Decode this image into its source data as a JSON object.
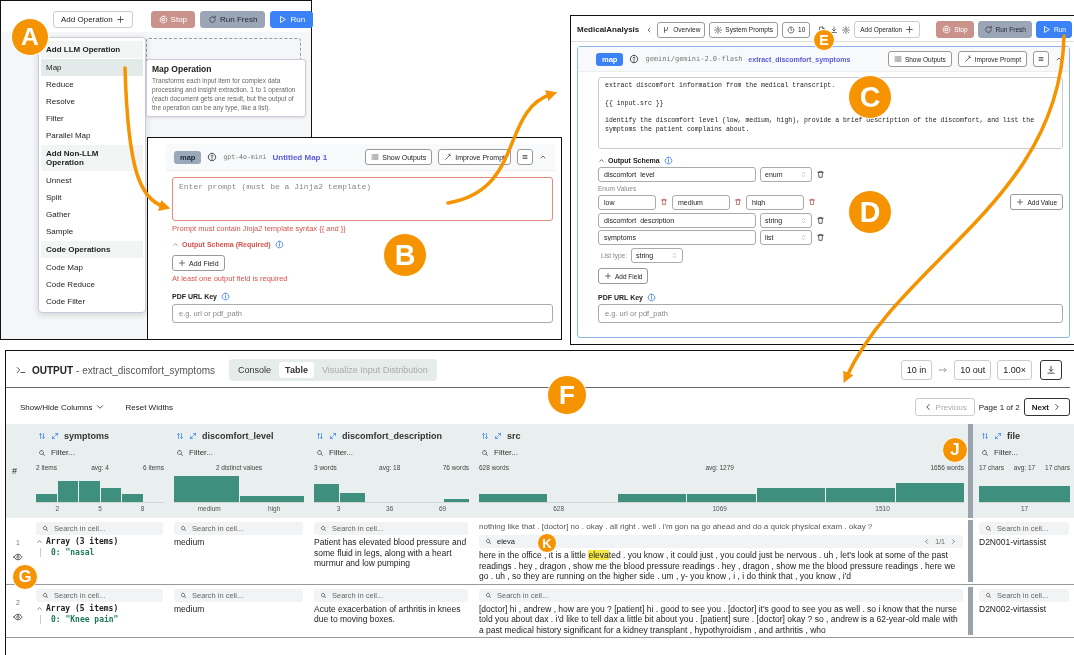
{
  "badges": [
    {
      "label": "A"
    },
    {
      "label": "B"
    },
    {
      "label": "C"
    },
    {
      "label": "D"
    },
    {
      "label": "E"
    },
    {
      "label": "F"
    },
    {
      "label": "G"
    },
    {
      "label": "J"
    },
    {
      "label": "K"
    }
  ],
  "panel_a": {
    "toolbar": [
      {
        "label": "Add Operation",
        "kind": "add"
      },
      {
        "label": "Stop",
        "kind": "stop"
      },
      {
        "label": "Run Fresh",
        "kind": "fresh"
      },
      {
        "label": "Run",
        "kind": "run"
      }
    ],
    "menu": [
      {
        "heading": "Add LLM Operation",
        "items": [
          {
            "label": "Map",
            "selected": true
          },
          {
            "label": "Reduce",
            "selected": false
          },
          {
            "label": "Resolve",
            "selected": false
          },
          {
            "label": "Filter",
            "selected": false
          },
          {
            "label": "Parallel Map",
            "selected": false
          }
        ]
      },
      {
        "heading": "Add Non-LLM Operation",
        "items": [
          {
            "label": "Unnest",
            "selected": false
          },
          {
            "label": "Split",
            "selected": false
          },
          {
            "label": "Gather",
            "selected": false
          },
          {
            "label": "Sample",
            "selected": false
          }
        ]
      },
      {
        "heading": "Code Operations",
        "items": [
          {
            "label": "Code Map",
            "selected": false
          },
          {
            "label": "Code Reduce",
            "selected": false
          },
          {
            "label": "Code Filter",
            "selected": false
          }
        ]
      }
    ],
    "tooltip": {
      "title": "Map Operation",
      "text": "Transforms each input item for complex data processing and insight extraction. 1 to 1 operation (each document gets one result, but the output of the operation can be any type, like a list)."
    }
  },
  "panel_b": {
    "op_type": "map",
    "model": "gpt-4o-mini",
    "name": "Untitled Map 1",
    "buttons": [
      {
        "label": "Show Outputs",
        "kind": "outputs"
      },
      {
        "label": "Improve Prompt",
        "kind": "improve"
      }
    ],
    "prompt": {
      "placeholder": "Enter prompt (must be a Jinja2 template)"
    },
    "prompt_error": "Prompt must contain Jinja2 template syntax {{ and }}",
    "schema_heading": "Output Schema (Required)",
    "add_field": "Add Field",
    "schema_error": "At least one output field is required",
    "pdf_label": "PDF URL Key",
    "pdf_input": {
      "placeholder": "e.g. url or pdf_path"
    }
  },
  "panel_c": {
    "title": "MedicalAnalysis",
    "nav": [
      {
        "label": "Overview",
        "kind": "branch"
      },
      {
        "label": "System Prompts",
        "kind": "gear"
      },
      {
        "label": "10",
        "kind": "clock"
      }
    ],
    "toolbar": [
      {
        "label": "Add Operation",
        "kind": "add"
      },
      {
        "label": "Stop",
        "kind": "stop"
      },
      {
        "label": "Run Fresh",
        "kind": "fresh"
      },
      {
        "label": "Run",
        "kind": "run"
      }
    ],
    "op_type": "map",
    "model": "gemini/gemini-2.0-flash",
    "name": "extract_discomfort_symptoms",
    "buttons": [
      {
        "label": "Show Outputs",
        "kind": "outputs"
      },
      {
        "label": "Improve Prompt",
        "kind": "improve"
      }
    ],
    "prompt": {
      "value": "extract discomfort information from the medical transcript.\n\n{{ input.src }}\n\nidentify the discomfort level (low, medium, high), provide a brief description of the discomfort, and list the symptoms the patient complains about."
    },
    "schema_heading": "Output Schema",
    "fields": [
      {
        "name": "discomfort_level",
        "type": "enum",
        "enum_label": "Enum Values",
        "enum_values": [
          "low",
          "medium",
          "high"
        ],
        "add_value": "Add Value"
      },
      {
        "name": "discomfort_description",
        "type": "string"
      },
      {
        "name": "symptoms",
        "type": "list",
        "list_label": "List type:",
        "list_type": "string"
      }
    ],
    "add_field": "Add Field",
    "pdf_label": "PDF URL Key",
    "pdf_input": {
      "placeholder": "e.g. url or pdf_path"
    }
  },
  "output": {
    "title": "OUTPUT",
    "subtitle": "- extract_discomfort_symptoms",
    "tabs": [
      {
        "label": "Console",
        "selected": false,
        "disabled": false
      },
      {
        "label": "Table",
        "selected": true,
        "disabled": false
      },
      {
        "label": "Visualize Input Distribution",
        "selected": false,
        "disabled": true
      }
    ],
    "count_in": "10 in",
    "count_out": "10 out",
    "speed": "1.00×",
    "show_hide": "Show/Hide Columns",
    "reset_widths": "Reset Widths",
    "previous": {
      "label": "Previous",
      "disabled": true
    },
    "page": "Page 1 of 2",
    "next": {
      "label": "Next",
      "disabled": false
    },
    "index_header": "#",
    "columns": [
      {
        "name": "symptoms",
        "filter_placeholder": "Filter...",
        "stats": [
          "2 items",
          "avg: 4",
          "6 items"
        ],
        "axis": [
          "2",
          "5",
          "8"
        ]
      },
      {
        "name": "discomfort_level",
        "filter_placeholder": "Filter...",
        "stats": [
          "2 distinct values"
        ],
        "axis": [
          "medium",
          "high"
        ]
      },
      {
        "name": "discomfort_description",
        "filter_placeholder": "Filter...",
        "stats": [
          "3 words",
          "avg: 18",
          "76 words"
        ],
        "axis": [
          "3",
          "36",
          "69"
        ]
      },
      {
        "name": "src",
        "filter_placeholder": "Filter...",
        "stats": [
          "628 words",
          "avg: 1279",
          "1656 words"
        ],
        "axis": [
          "628",
          "1069",
          "1510"
        ]
      },
      {
        "name": "file",
        "filter_placeholder": "Filter...",
        "stats": [
          "17 chars",
          "avg: 17",
          "17 chars"
        ],
        "axis": [
          "17"
        ]
      }
    ],
    "rows": [
      {
        "index": "1",
        "search": [
          {
            "placeholder": "Search in cell..."
          },
          {
            "placeholder": "Search in cell..."
          },
          {
            "placeholder": "Search in cell..."
          },
          {
            "value": "eleva",
            "matches": "1/1"
          },
          {
            "placeholder": "Search in cell..."
          }
        ],
        "symptoms": {
          "summary": "Array (3 items)",
          "first": "0: \"nasal"
        },
        "discomfort_level": "medium",
        "description": "Patient has elevated blood pressure and some fluid in legs, along with a heart murmur and low pumping",
        "src_above": "nothing like that . [doctor] no . okay . all right . well . i'm gon na go ahead and do a quick physical exam . okay ?",
        "src": [
          {
            "text": "here in the office , it is a little ",
            "highlighted": false
          },
          {
            "text": "eleva",
            "highlighted": true
          },
          {
            "text": "ted . you know , it could just , you could just be nervous . uh , let's look at some of the past readings . hey , dragon , show me the blood pressure readings . hey , dragon , show me the blood pressure readings . here we go . uh , so they are running on the higher side . um , y- you know , i , i do think that , you know , i'd",
            "highlighted": false
          }
        ],
        "file": "D2N001-virtassist"
      },
      {
        "index": "2",
        "search": [
          {
            "placeholder": "Search in cell..."
          },
          {
            "placeholder": "Search in cell..."
          },
          {
            "placeholder": "Search in cell..."
          },
          {
            "placeholder": "Search in cell..."
          },
          {
            "placeholder": "Search in cell..."
          }
        ],
        "symptoms": {
          "summary": "Array (5 items)",
          "first": "0: \"Knee pain\""
        },
        "discomfort_level": "medium",
        "description": "Acute exacerbation of arthritis in knees due to moving boxes.",
        "src": [
          {
            "text": "[doctor] hi , andrew , how are you ? [patient] hi . good to see you . [doctor] it's good to see you as well . so i know that the nurse told you about dax . i'd like to tell dax a little bit about you . [patient] sure . [doctor] okay ? so , andrew is a 62-year-old male with a past medical history significant for a kidney transplant , hypothyroidism , and arthritis , who",
            "highlighted": false
          }
        ],
        "file": "D2N002-virtassist"
      }
    ]
  }
}
